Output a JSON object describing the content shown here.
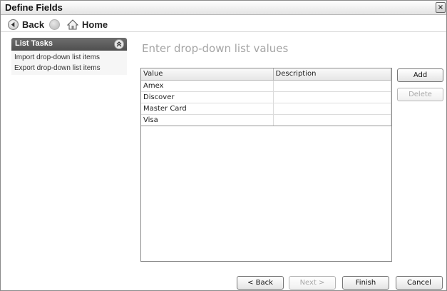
{
  "window": {
    "title": "Define Fields",
    "close_glyph": "×"
  },
  "navbar": {
    "back_label": "Back",
    "home_label": "Home"
  },
  "sidebar": {
    "title": "List Tasks",
    "items": [
      {
        "label": "Import drop-down list items"
      },
      {
        "label": "Export drop-down list items"
      }
    ]
  },
  "main": {
    "heading": "Enter drop-down list values",
    "columns": [
      "Value",
      "Description"
    ],
    "rows": [
      {
        "value": "Amex",
        "description": ""
      },
      {
        "value": "Discover",
        "description": ""
      },
      {
        "value": "Master Card",
        "description": ""
      },
      {
        "value": "Visa",
        "description": ""
      }
    ]
  },
  "actions": {
    "add_label": "Add",
    "delete_label": "Delete",
    "delete_enabled": false
  },
  "footer": {
    "back_label": "< Back",
    "next_label": "Next >",
    "next_enabled": false,
    "finish_label": "Finish",
    "cancel_label": "Cancel"
  },
  "icons": {
    "back": "back-arrow-icon",
    "forward": "forward-arrow-icon",
    "home": "home-icon",
    "collapse": "chevron-up-double-icon",
    "close": "close-icon"
  },
  "colors": {
    "sidebar_header": "#5a5a5a",
    "heading_text": "#a5a5a5",
    "disabled_text": "#a8a8a8"
  }
}
